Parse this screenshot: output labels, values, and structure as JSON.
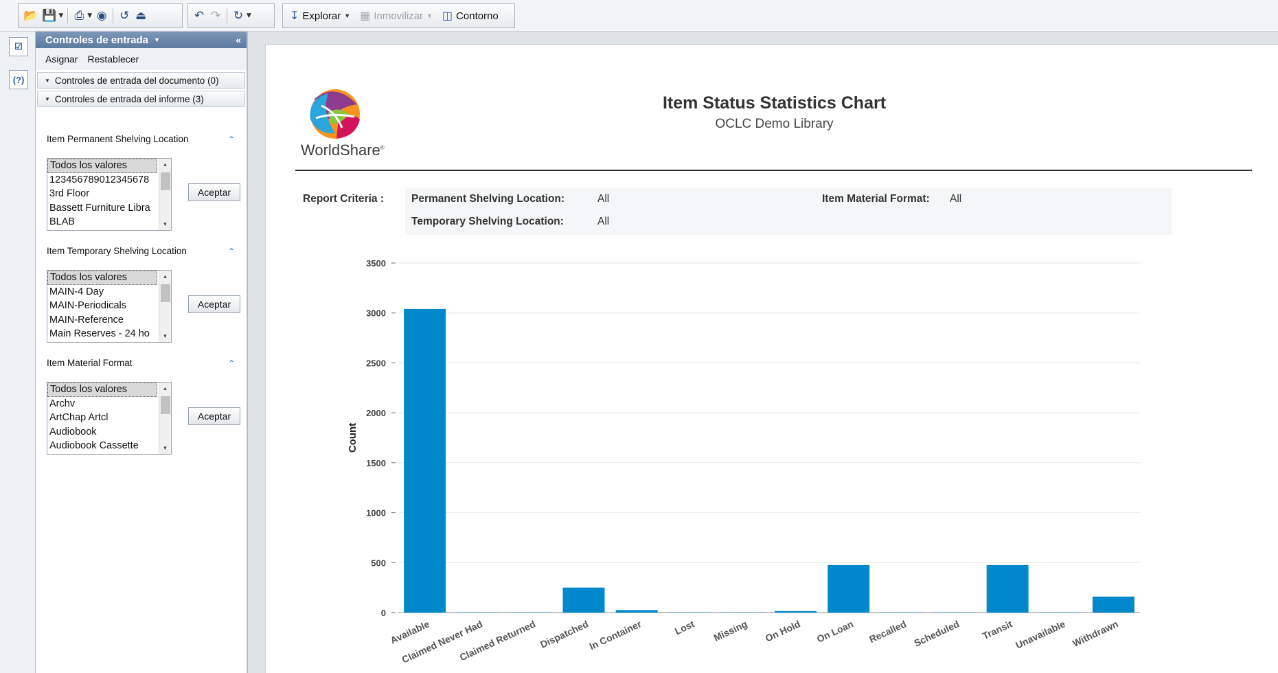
{
  "toolbar": {
    "explore_label": "Explorar",
    "freeze_label": "Inmovilizar",
    "outline_label": "Contorno"
  },
  "panel": {
    "title": "Controles de entrada",
    "assign_label": "Asignar",
    "reset_label": "Restablecer",
    "document_section": "Controles de entrada del documento (0)",
    "report_section": "Controles de entrada del informe (3)",
    "controls": [
      {
        "title": "Item Permanent Shelving Location",
        "items": [
          "Todos los valores",
          "123456789012345678",
          "3rd Floor",
          "Bassett Furniture Libra",
          "BLAB"
        ],
        "accept": "Aceptar"
      },
      {
        "title": "Item Temporary Shelving Location",
        "items": [
          "Todos los valores",
          "MAIN-4 Day",
          "MAIN-Periodicals",
          "MAIN-Reference",
          "Main Reserves - 24 ho"
        ],
        "accept": "Aceptar"
      },
      {
        "title": "Item Material Format",
        "items": [
          "Todos los valores",
          "Archv",
          "ArtChap Artcl",
          "Audiobook",
          "Audiobook Cassette"
        ],
        "accept": "Aceptar"
      }
    ]
  },
  "report": {
    "logo_text": "WorldShare",
    "title": "Item Status Statistics Chart",
    "subtitle": "OCLC Demo Library",
    "criteria_label": "Report Criteria :",
    "criteria": {
      "permanent_label": "Permanent Shelving Location:",
      "permanent_value": "All",
      "temporary_label": "Temporary Shelving Location:",
      "temporary_value": "All",
      "format_label": "Item Material Format:",
      "format_value": "All"
    }
  },
  "chart_data": {
    "type": "bar",
    "ylabel": "Count",
    "xlabel": "",
    "ylim": [
      0,
      3500
    ],
    "yticks": [
      0,
      500,
      1000,
      1500,
      2000,
      2500,
      3000,
      3500
    ],
    "categories": [
      "Available",
      "Claimed Never Had",
      "Claimed Returned",
      "Dispatched",
      "In Container",
      "Lost",
      "Missing",
      "On Hold",
      "On Loan",
      "Recalled",
      "Scheduled",
      "Transit",
      "Unavailable",
      "Withdrawn"
    ],
    "values": [
      3040,
      2,
      2,
      250,
      25,
      2,
      2,
      15,
      475,
      2,
      2,
      475,
      2,
      160
    ],
    "bar_color": "#0088cc",
    "grid": true
  }
}
